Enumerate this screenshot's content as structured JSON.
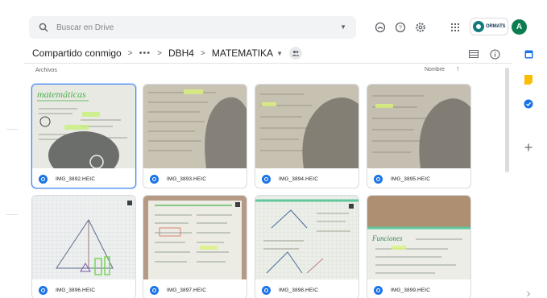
{
  "search": {
    "placeholder": "Buscar en Drive"
  },
  "account": {
    "brand_label": "ORMATS",
    "avatar_initial": "A"
  },
  "breadcrumb": {
    "items": [
      "Compartido conmigo",
      "•••",
      "DBH4",
      "MATEMATIKA"
    ]
  },
  "list_header": {
    "section": "Archivos",
    "sort_label": "Nombre"
  },
  "files": [
    {
      "name": "IMG_3892.HEIC",
      "selected": true
    },
    {
      "name": "IMG_3893.HEIC",
      "selected": false
    },
    {
      "name": "IMG_3894.HEIC",
      "selected": false
    },
    {
      "name": "IMG_3895.HEIC",
      "selected": false
    },
    {
      "name": "IMG_3896.HEIC",
      "selected": false
    },
    {
      "name": "IMG_3897.HEIC",
      "selected": false
    },
    {
      "name": "IMG_3898.HEIC",
      "selected": false
    },
    {
      "name": "IMG_3899.HEIC",
      "selected": false
    }
  ],
  "icons": {
    "search": "search-icon",
    "status": "offline-status-icon",
    "help": "help-icon",
    "settings": "gear-icon",
    "apps": "apps-grid-icon",
    "view": "list-view-icon",
    "info": "info-icon",
    "calendar": "calendar-icon",
    "keep": "keep-icon",
    "tasks": "tasks-icon",
    "add": "plus-icon"
  },
  "colors": {
    "accent": "#1a73e8",
    "avatar": "#0b7d4f",
    "selection": "#4285f4"
  }
}
